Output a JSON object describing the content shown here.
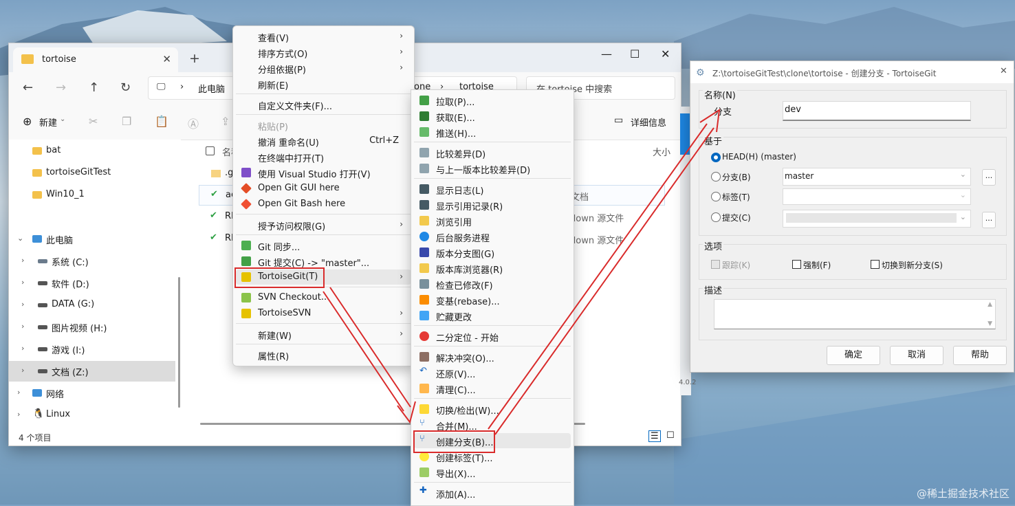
{
  "explorer": {
    "tab_title": "tortoise",
    "tab_close": "✕",
    "tab_add": "+",
    "address": {
      "pc": "此电脑",
      "clone": "one",
      "folder": "tortoise"
    },
    "search_placeholder": "在 tortoise 中搜索",
    "toolbar": {
      "new_label": "新建",
      "details_label": "详细信息"
    },
    "sidebar": [
      {
        "label": "bat",
        "type": "folder"
      },
      {
        "label": "tortoiseGitTest",
        "type": "folder"
      },
      {
        "label": "Win10_1",
        "type": "folder"
      },
      {
        "label": "此电脑",
        "type": "pc"
      },
      {
        "label": "系统 (C:)",
        "type": "drive"
      },
      {
        "label": "软件 (D:)",
        "type": "drive"
      },
      {
        "label": "DATA (G:)",
        "type": "drive"
      },
      {
        "label": "图片视频 (H:)",
        "type": "drive"
      },
      {
        "label": "游戏 (I:)",
        "type": "drive"
      },
      {
        "label": "文档 (Z:)",
        "type": "drive"
      },
      {
        "label": "网络",
        "type": "network"
      },
      {
        "label": "Linux",
        "type": "linux"
      }
    ],
    "columns": {
      "name": "名称",
      "size": "大小"
    },
    "files": [
      {
        "name": ".g",
        "type_text": ""
      },
      {
        "name": "ac",
        "type_text": "文档"
      },
      {
        "name": "RE",
        "type_text": "down 源文件"
      },
      {
        "name": "RE",
        "type_text": "down 源文件"
      }
    ],
    "status": "4 个项目"
  },
  "context_menu": [
    {
      "label": "查看(V)",
      "arrow": true
    },
    {
      "label": "排序方式(O)",
      "arrow": true
    },
    {
      "label": "分组依据(P)",
      "arrow": true
    },
    {
      "label": "刷新(E)"
    },
    {
      "label": "自定义文件夹(F)..."
    },
    {
      "label": "粘贴(P)",
      "disabled": true
    },
    {
      "label": "撤消 重命名(U)",
      "shortcut": "Ctrl+Z"
    },
    {
      "label": "在终端中打开(T)"
    },
    {
      "label": "使用 Visual Studio 打开(V)"
    },
    {
      "label": "Open Git GUI here"
    },
    {
      "label": "Open Git Bash here"
    },
    {
      "label": "授予访问权限(G)",
      "arrow": true
    },
    {
      "label": "Git 同步..."
    },
    {
      "label": "Git 提交(C) -> \"master\"..."
    },
    {
      "label": "TortoiseGit(T)",
      "arrow": true
    },
    {
      "label": "SVN Checkout..."
    },
    {
      "label": "TortoiseSVN",
      "arrow": true
    },
    {
      "label": "新建(W)",
      "arrow": true
    },
    {
      "label": "属性(R)"
    }
  ],
  "submenu": [
    "拉取(P)...",
    "获取(E)...",
    "推送(H)...",
    "比较差异(D)",
    "与上一版本比较差异(D)",
    "显示日志(L)",
    "显示引用记录(R)",
    "浏览引用",
    "后台服务进程",
    "版本分支图(G)",
    "版本库浏览器(R)",
    "检查已修改(F)",
    "变基(rebase)...",
    "贮藏更改",
    "二分定位 - 开始",
    "解决冲突(O)...",
    "还原(V)...",
    "清理(C)...",
    "切换/检出(W)...",
    "合并(M)...",
    "创建分支(B)...",
    "创建标签(T)...",
    "导出(X)...",
    "添加(A)..."
  ],
  "dialog": {
    "title": "Z:\\tortoiseGitTest\\clone\\tortoise - 创建分支 - TortoiseGit",
    "close": "✕",
    "name_group": "名称(N)",
    "branch_label": "分支",
    "branch_value": "dev",
    "base_group": "基于",
    "head_option": "HEAD(H) (master)",
    "branch_option": "分支(B)",
    "branch_combo": "master",
    "tag_option": "标签(T)",
    "commit_option": "提交(C)",
    "browse": "...",
    "options_group": "选项",
    "track": "跟踪(K)",
    "force": "强制(F)",
    "switch": "切换到新分支(S)",
    "desc_group": "描述",
    "ok": "确定",
    "cancel": "取消",
    "help": "帮助"
  },
  "background_fragments": {
    "version": "4.0.2"
  },
  "watermark": "@稀土掘金技术社区",
  "colors": {
    "accent": "#0067c0",
    "highlight": "#d92b2b",
    "folder": "#f3c14b"
  }
}
